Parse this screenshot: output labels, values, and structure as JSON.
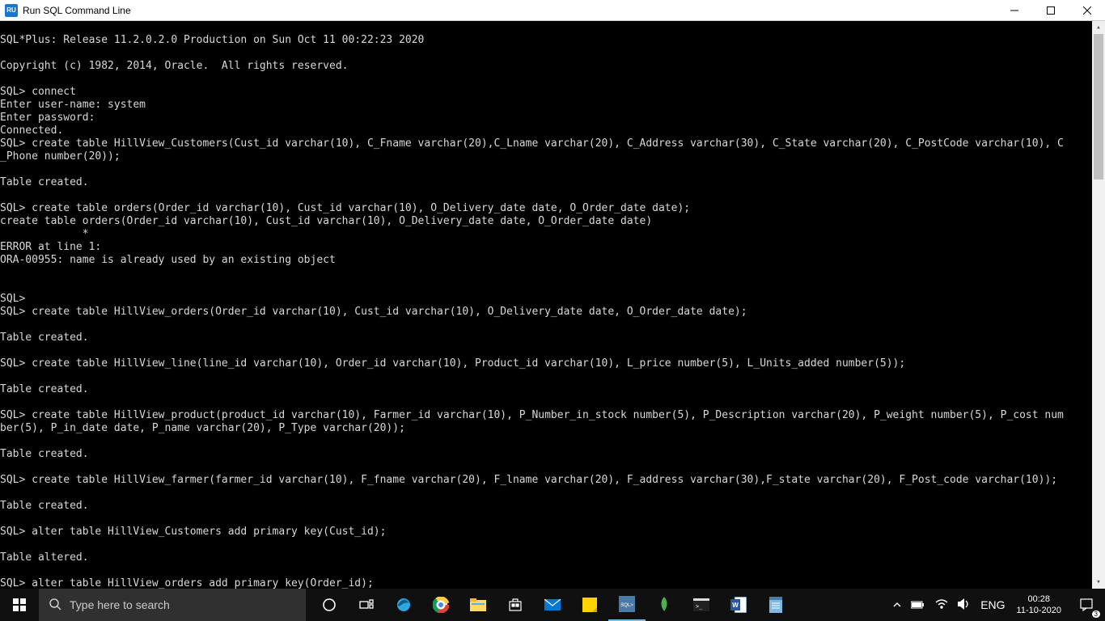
{
  "window": {
    "title": "Run SQL Command Line",
    "icon_text": "RU"
  },
  "terminal_text": "\nSQL*Plus: Release 11.2.0.2.0 Production on Sun Oct 11 00:22:23 2020\n\nCopyright (c) 1982, 2014, Oracle.  All rights reserved.\n\nSQL> connect\nEnter user-name: system\nEnter password:\nConnected.\nSQL> create table HillView_Customers(Cust_id varchar(10), C_Fname varchar(20),C_Lname varchar(20), C_Address varchar(30), C_State varchar(20), C_PostCode varchar(10), C\n_Phone number(20));\n\nTable created.\n\nSQL> create table orders(Order_id varchar(10), Cust_id varchar(10), O_Delivery_date date, O_Order_date date);\ncreate table orders(Order_id varchar(10), Cust_id varchar(10), O_Delivery_date date, O_Order_date date)\n             *\nERROR at line 1:\nORA-00955: name is already used by an existing object\n\n\nSQL>\nSQL> create table HillView_orders(Order_id varchar(10), Cust_id varchar(10), O_Delivery_date date, O_Order_date date);\n\nTable created.\n\nSQL> create table HillView_line(line_id varchar(10), Order_id varchar(10), Product_id varchar(10), L_price number(5), L_Units_added number(5));\n\nTable created.\n\nSQL> create table HillView_product(product_id varchar(10), Farmer_id varchar(10), P_Number_in_stock number(5), P_Description varchar(20), P_weight number(5), P_cost num\nber(5), P_in_date date, P_name varchar(20), P_Type varchar(20));\n\nTable created.\n\nSQL> create table HillView_farmer(farmer_id varchar(10), F_fname varchar(20), F_lname varchar(20), F_address varchar(30),F_state varchar(20), F_Post_code varchar(10));\n\nTable created.\n\nSQL> alter table HillView_Customers add primary key(Cust_id);\n\nTable altered.\n\nSQL> alter table HillView_orders add primary key(Order_id);",
  "taskbar": {
    "search_placeholder": "Type here to search",
    "lang": "ENG",
    "time": "00:28",
    "date": "11-10-2020",
    "notif_count": "3"
  }
}
